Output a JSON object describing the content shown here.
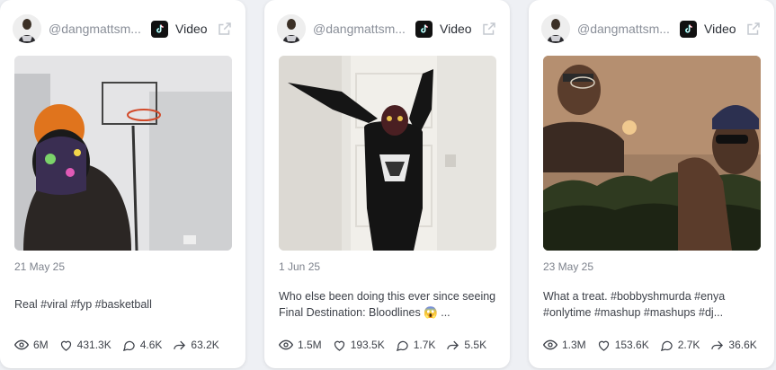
{
  "cards": [
    {
      "handle": "@dangmattsm...",
      "type_label": "Video",
      "date": "21 May 25",
      "caption": "Real #viral #fyp #basketball",
      "stats": {
        "views": "6M",
        "likes": "431.3K",
        "comments": "4.6K",
        "shares": "63.2K"
      }
    },
    {
      "handle": "@dangmattsm...",
      "type_label": "Video",
      "date": "1 Jun 25",
      "caption": "Who else been doing this ever since seeing Final Destination: Bloodlines 😱 ...",
      "stats": {
        "views": "1.5M",
        "likes": "193.5K",
        "comments": "1.7K",
        "shares": "5.5K"
      }
    },
    {
      "handle": "@dangmattsm...",
      "type_label": "Video",
      "date": "23 May 25",
      "caption": "What a treat. #bobbyshmurda #enya #onlytime #mashup #mashups #dj...",
      "stats": {
        "views": "1.3M",
        "likes": "153.6K",
        "comments": "2.7K",
        "shares": "36.6K"
      }
    }
  ],
  "icons": {
    "platform": "tiktok-icon",
    "open": "external-link-icon",
    "views": "eye-icon",
    "likes": "heart-icon",
    "comments": "comment-icon",
    "shares": "share-icon"
  },
  "colors": {
    "background": "#eef0f4",
    "card": "#ffffff",
    "muted_text": "#8a8f99",
    "body_text": "#3d4149"
  }
}
